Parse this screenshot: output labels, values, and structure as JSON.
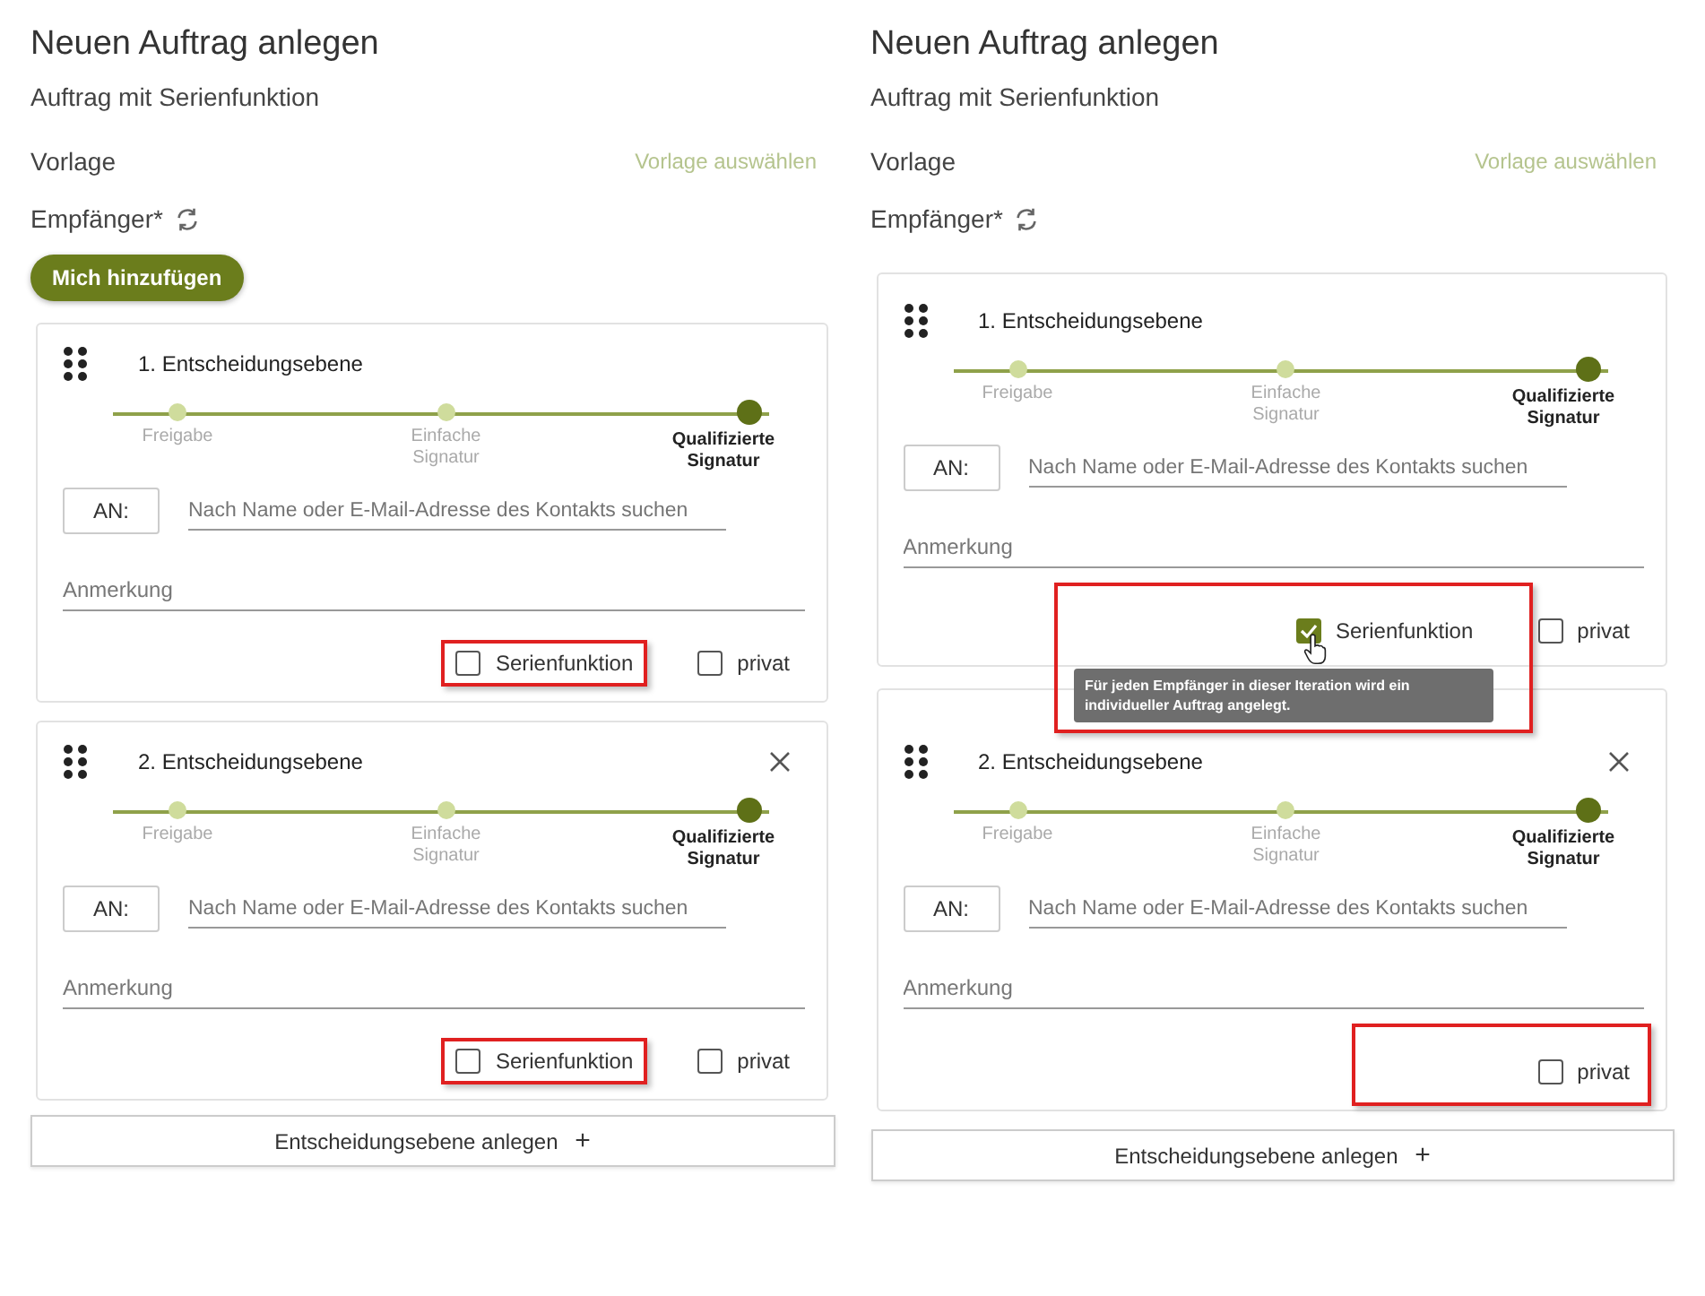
{
  "panels": [
    {
      "title": "Neuen Auftrag anlegen",
      "subtitle": "Auftrag mit Serienfunktion",
      "template_label": "Vorlage",
      "template_link": "Vorlage auswählen",
      "recipients_label": "Empfänger*",
      "add_me_button": "Mich hinzufügen",
      "levels": [
        {
          "title": "1. Entscheidungsebene",
          "removable": false,
          "steps": [
            {
              "label": "Freigabe",
              "selected": false
            },
            {
              "label": "Einfache Signatur",
              "selected": false
            },
            {
              "label": "Qualifizierte Signatur",
              "selected": true
            }
          ],
          "to_label": "AN:",
          "search": {
            "placeholder": "Nach Name oder E-Mail-Adresse des Kontakts suchen"
          },
          "remark": {
            "placeholder": "Anmerkung"
          },
          "highlight_row": false,
          "options": [
            {
              "label": "Serienfunktion",
              "checked": false,
              "highlighted": true
            },
            {
              "label": "privat",
              "checked": false,
              "highlighted": false
            }
          ]
        },
        {
          "title": "2. Entscheidungsebene",
          "removable": true,
          "steps": [
            {
              "label": "Freigabe",
              "selected": false
            },
            {
              "label": "Einfache Signatur",
              "selected": false
            },
            {
              "label": "Qualifizierte Signatur",
              "selected": true
            }
          ],
          "to_label": "AN:",
          "search": {
            "placeholder": "Nach Name oder E-Mail-Adresse des Kontakts suchen"
          },
          "remark": {
            "placeholder": "Anmerkung"
          },
          "highlight_row": false,
          "options": [
            {
              "label": "Serienfunktion",
              "checked": false,
              "highlighted": true
            },
            {
              "label": "privat",
              "checked": false,
              "highlighted": false
            }
          ]
        }
      ],
      "add_level_button": "Entscheidungsebene anlegen",
      "add_level_icon": "+"
    },
    {
      "title": "Neuen Auftrag anlegen",
      "subtitle": "Auftrag mit Serienfunktion",
      "template_label": "Vorlage",
      "template_link": "Vorlage auswählen",
      "recipients_label": "Empfänger*",
      "levels": [
        {
          "title": "1. Entscheidungsebene",
          "removable": false,
          "steps": [
            {
              "label": "Freigabe",
              "selected": false
            },
            {
              "label": "Einfache Signatur",
              "selected": false
            },
            {
              "label": "Qualifizierte Signatur",
              "selected": true
            }
          ],
          "to_label": "AN:",
          "search": {
            "placeholder": "Nach Name oder E-Mail-Adresse des Kontakts suchen"
          },
          "remark": {
            "placeholder": "Anmerkung"
          },
          "highlight_row": true,
          "tooltip": "Für jeden Empfänger in dieser Iteration wird ein individueller Auftrag angelegt.",
          "options": [
            {
              "label": "Serienfunktion",
              "checked": true,
              "highlighted": false
            },
            {
              "label": "privat",
              "checked": false,
              "highlighted": false
            }
          ]
        },
        {
          "title": "2. Entscheidungsebene",
          "removable": true,
          "steps": [
            {
              "label": "Freigabe",
              "selected": false
            },
            {
              "label": "Einfache Signatur",
              "selected": false
            },
            {
              "label": "Qualifizierte Signatur",
              "selected": true
            }
          ],
          "to_label": "AN:",
          "search": {
            "placeholder": "Nach Name oder E-Mail-Adresse des Kontakts suchen"
          },
          "remark": {
            "placeholder": "Anmerkung"
          },
          "highlight_row": true,
          "options": [
            {
              "label": "privat",
              "checked": false,
              "highlighted": false
            }
          ]
        }
      ],
      "add_level_button": "Entscheidungsebene anlegen",
      "add_level_icon": "+"
    }
  ]
}
